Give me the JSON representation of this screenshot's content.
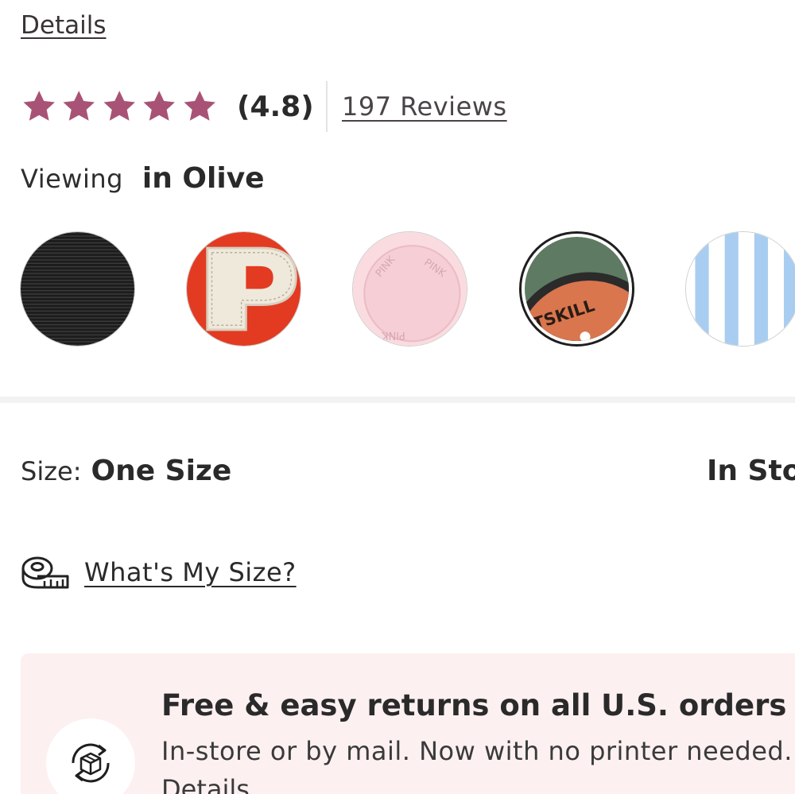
{
  "header": {
    "details_link": "Details"
  },
  "rating": {
    "stars": 5,
    "value_label": "(4.8)",
    "reviews_link": "197 Reviews",
    "star_color": "#a85375"
  },
  "color_selector": {
    "label": "Viewing",
    "selected_color": "in Olive",
    "swatches": [
      {
        "name": "black-stripe",
        "selected": false
      },
      {
        "name": "red-varsity-p",
        "selected": false
      },
      {
        "name": "pink-logo",
        "selected": false
      },
      {
        "name": "olive-patch",
        "selected": true
      },
      {
        "name": "blue-stripe",
        "selected": false
      }
    ],
    "olive_patch_text": "TSKILL",
    "pink_logo_text": "PINK"
  },
  "size": {
    "label": "Size:",
    "value": "One Size",
    "stock_status": "In Stock"
  },
  "size_guide": {
    "label": "What's My Size?",
    "icon": "measuring-tape-icon"
  },
  "returns": {
    "title": "Free & easy returns on all U.S. orders",
    "subtitle": "In-store or by mail. Now with no printer needed.",
    "details_link": "Details",
    "icon": "return-package-icon",
    "background": "#fdf0f1"
  }
}
